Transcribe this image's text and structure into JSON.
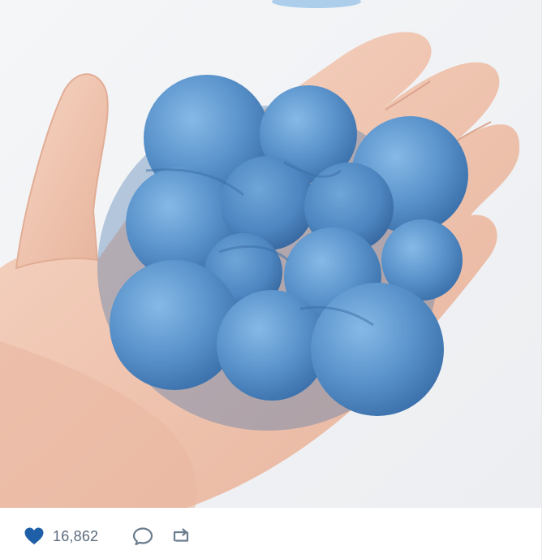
{
  "post": {
    "image": {
      "subject": "hand-holding-blue-bubble-sponge",
      "colors": {
        "sponge": "#5b94cc",
        "sponge_shadow": "#3f77b3",
        "sponge_highlight": "#7bb0e0",
        "skin": "#f0c9b6",
        "skin_shadow": "#d9a692",
        "background": "#f1f2f4"
      }
    },
    "actions": {
      "like_icon": "heart-icon",
      "like_count": "16,862",
      "like_color": "#1e5fa8",
      "reply_icon": "speech-bubble-icon",
      "retweet_icon": "retweet-icon",
      "icon_color": "#6a7c8e"
    }
  }
}
